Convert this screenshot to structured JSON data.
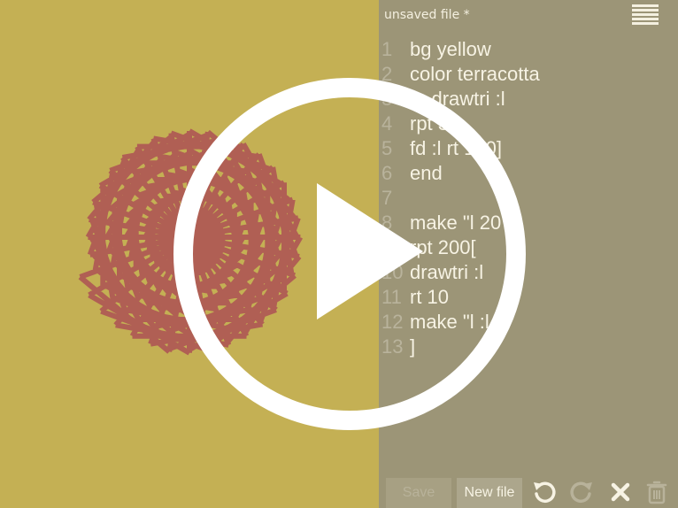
{
  "colors": {
    "background_yellow": "#c4b054",
    "terracotta": "#b05f54",
    "editor_bg": "#9c9577",
    "editor_text": "#f7f3e4",
    "line_number": "#b9b39c",
    "overlay_white": "#ffffff"
  },
  "editor": {
    "file_title": "unsaved file *",
    "menu_icon": "hamburger-menu-icon",
    "lines": [
      {
        "num": "1",
        "text": "bg yellow"
      },
      {
        "num": "2",
        "text": "color terracotta"
      },
      {
        "num": "3",
        "text": "to drawtri :l"
      },
      {
        "num": "4",
        "text": "rpt 3["
      },
      {
        "num": "5",
        "text": "fd :l rt 120]"
      },
      {
        "num": "6",
        "text": "end"
      },
      {
        "num": "7",
        "text": ""
      },
      {
        "num": "8",
        "text": "make \"l 20"
      },
      {
        "num": "9",
        "text": "rpt 200["
      },
      {
        "num": "10",
        "text": "drawtri :l"
      },
      {
        "num": "11",
        "text": "rt 10"
      },
      {
        "num": "12",
        "text": "make \"l :l"
      },
      {
        "num": "13",
        "text": "]"
      }
    ]
  },
  "toolbar": {
    "save_label": "Save",
    "new_file_label": "New file",
    "undo_icon": "undo-icon",
    "redo_icon": "redo-icon",
    "clear_icon": "close-icon",
    "delete_icon": "trash-icon"
  },
  "overlay": {
    "play_icon": "play-icon"
  }
}
